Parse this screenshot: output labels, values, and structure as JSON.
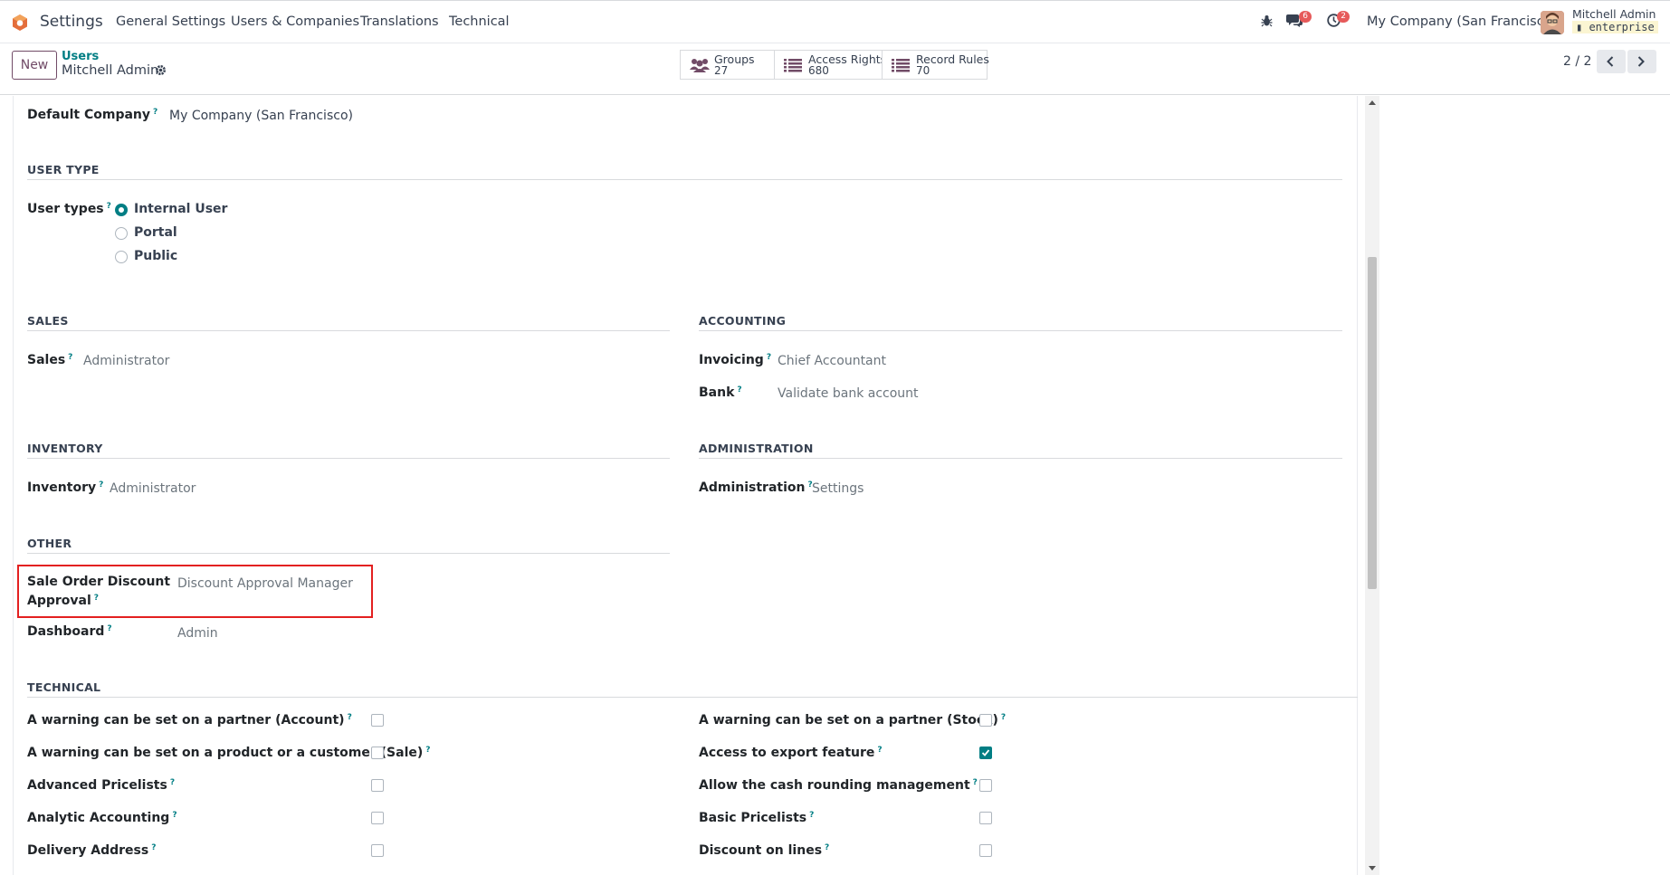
{
  "navbar": {
    "app_name": "Settings",
    "menu": [
      "General Settings",
      "Users & Companies",
      "Translations",
      "Technical"
    ],
    "messages_badge": "6",
    "activities_badge": "2",
    "company": "My Company (San Francisco)",
    "user_name": "Mitchell Admin",
    "database": "enterprise"
  },
  "control_panel": {
    "new_label": "New",
    "breadcrumb_parent": "Users",
    "breadcrumb_current": "Mitchell Admin",
    "smart_buttons": [
      {
        "label": "Groups",
        "value": "27"
      },
      {
        "label": "Access Rights",
        "value": "680"
      },
      {
        "label": "Record Rules",
        "value": "70"
      }
    ],
    "pager": "2 / 2"
  },
  "form": {
    "q": "?",
    "default_company": {
      "label": "Default Company",
      "value": "My Company (San Francisco)"
    },
    "user_type": {
      "section": "USER TYPE",
      "label": "User types",
      "options": [
        "Internal User",
        "Portal",
        "Public"
      ],
      "selected": "Internal User"
    },
    "sales": {
      "section": "SALES",
      "label": "Sales",
      "value": "Administrator"
    },
    "accounting": {
      "section": "ACCOUNTING",
      "invoicing_label": "Invoicing",
      "invoicing_value": "Chief Accountant",
      "bank_label": "Bank",
      "bank_value": "Validate bank account"
    },
    "inventory": {
      "section": "INVENTORY",
      "label": "Inventory",
      "value": "Administrator"
    },
    "administration": {
      "section": "ADMINISTRATION",
      "label": "Administration",
      "value": "Settings"
    },
    "other": {
      "section": "OTHER",
      "sod_label_1": "Sale Order Discount",
      "sod_label_2": "Approval",
      "sod_value": "Discount Approval Manager",
      "dashboard_label": "Dashboard",
      "dashboard_value": "Admin"
    },
    "technical": {
      "section": "TECHNICAL",
      "left": [
        {
          "label": "A warning can be set on a partner (Account)",
          "checked": false
        },
        {
          "label": "A warning can be set on a product or a customer (Sale)",
          "checked": false
        },
        {
          "label": "Advanced Pricelists",
          "checked": false
        },
        {
          "label": "Analytic Accounting",
          "checked": false
        },
        {
          "label": "Delivery Address",
          "checked": false
        }
      ],
      "right": [
        {
          "label": "A warning can be set on a partner (Stock)",
          "checked": false
        },
        {
          "label": "Access to export feature",
          "checked": true
        },
        {
          "label": "Allow the cash rounding management",
          "checked": false
        },
        {
          "label": "Basic Pricelists",
          "checked": false
        },
        {
          "label": "Discount on lines",
          "checked": false
        }
      ]
    }
  },
  "colors": {
    "accent": "#017e84",
    "brand": "#714b67",
    "highlight": "#e32020"
  }
}
